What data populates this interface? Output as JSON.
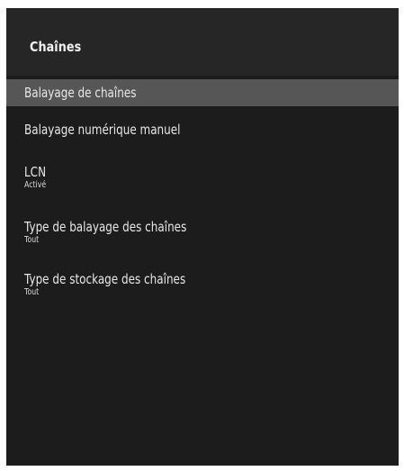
{
  "screen": {
    "title": "Chaînes"
  },
  "menu": {
    "items": [
      {
        "label": "Balayage de chaînes",
        "selected": true
      },
      {
        "label": "Balayage numérique manuel"
      },
      {
        "label": "LCN",
        "value": "Activé"
      },
      {
        "label": "Type de balayage des chaînes",
        "value": "Tout"
      },
      {
        "label": "Type de stockage des chaînes",
        "value": "Tout"
      }
    ]
  },
  "colors": {
    "header_bg": "#262626",
    "list_bg": "#1c1c1c",
    "selected_bg": "#565656",
    "text": "#e8e8e8"
  }
}
